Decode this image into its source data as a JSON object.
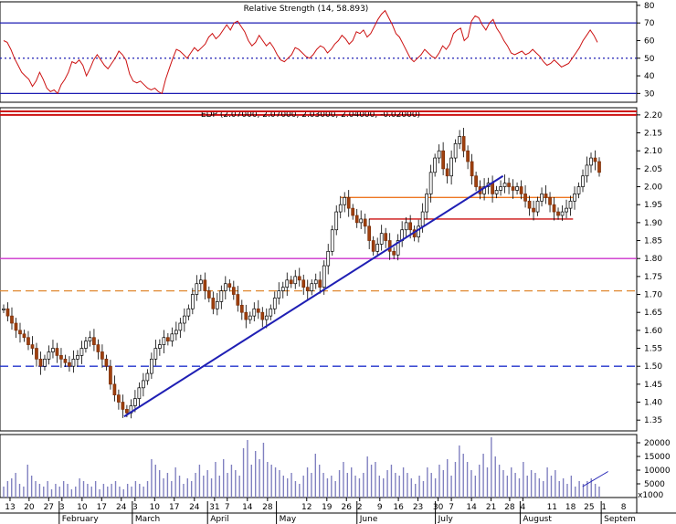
{
  "window": {
    "title": ""
  },
  "chart_data": [
    {
      "type": "line",
      "title": "Relative Strength (14, 58.893)",
      "ylim": [
        25,
        82
      ],
      "yticks": [
        30,
        40,
        50,
        60,
        70,
        80
      ],
      "grid": false,
      "reference_lines": [
        {
          "value": 70,
          "style": "solid",
          "color": "#1f1fb4"
        },
        {
          "value": 50,
          "style": "dotted",
          "color": "#1f1fb4"
        },
        {
          "value": 30,
          "style": "solid",
          "color": "#1f1fb4"
        }
      ],
      "series": [
        {
          "color": "#cc1111",
          "values": [
            60,
            59,
            55,
            50,
            46,
            42,
            40,
            38,
            34,
            37,
            42,
            38,
            33,
            31,
            32,
            30,
            35,
            38,
            42,
            48,
            47,
            49,
            46,
            40,
            44,
            49,
            52,
            49,
            46,
            44,
            47,
            50,
            54,
            52,
            49,
            41,
            37,
            36,
            37,
            35,
            33,
            32,
            33,
            31,
            30,
            38,
            44,
            50,
            55,
            54,
            52,
            50,
            53,
            56,
            54,
            56,
            58,
            62,
            64,
            61,
            63,
            66,
            69,
            66,
            70,
            71,
            68,
            65,
            60,
            57,
            59,
            63,
            60,
            57,
            59,
            56,
            52,
            49,
            48,
            50,
            52,
            56,
            55,
            53,
            51,
            50,
            52,
            55,
            57,
            56,
            53,
            55,
            58,
            60,
            63,
            61,
            58,
            60,
            65,
            64,
            66,
            62,
            64,
            68,
            72,
            75,
            77,
            73,
            69,
            64,
            62,
            58,
            54,
            50,
            48,
            50,
            52,
            55,
            53,
            51,
            50,
            53,
            57,
            55,
            58,
            64,
            66,
            67,
            60,
            62,
            71,
            74,
            73,
            69,
            66,
            70,
            72,
            67,
            64,
            60,
            57,
            53,
            52,
            53,
            54,
            52,
            53,
            55,
            53,
            51,
            48,
            46,
            47,
            49,
            47,
            45,
            46,
            47,
            50,
            53,
            56,
            60,
            63,
            66,
            63,
            59
          ]
        }
      ]
    },
    {
      "type": "candlestick",
      "title": "EDP (2.07000, 2.07000, 2.03000, 2.04000, -0.02000)",
      "ylim": [
        1.32,
        2.22
      ],
      "yticks": [
        1.35,
        1.4,
        1.45,
        1.5,
        1.55,
        1.6,
        1.65,
        1.7,
        1.75,
        1.8,
        1.85,
        1.9,
        1.95,
        2.0,
        2.05,
        2.1,
        2.15,
        2.2
      ],
      "grid": false,
      "reference_lines": [
        {
          "value": 2.2,
          "style": "solid",
          "color": "#cc1111"
        },
        {
          "value": 1.8,
          "style": "solid",
          "color": "#cc33cc"
        },
        {
          "value": 1.71,
          "style": "dashed",
          "color": "#e08a33"
        },
        {
          "value": 1.5,
          "style": "dashed",
          "color": "#2233cc"
        },
        {
          "value": 1.97,
          "style": "solid",
          "color": "#ee7722",
          "from": 0.535,
          "to": 0.9
        },
        {
          "value": 1.91,
          "style": "solid",
          "color": "#cc1111",
          "from": 0.58,
          "to": 0.9
        }
      ],
      "trend_lines": [
        {
          "color": "#1f1fb4",
          "from": [
            0.195,
            1.36
          ],
          "to": [
            0.79,
            2.03
          ]
        }
      ],
      "series": [
        {
          "name": "EDP",
          "close": [
            1.66,
            1.64,
            1.62,
            1.6,
            1.59,
            1.58,
            1.56,
            1.55,
            1.52,
            1.5,
            1.52,
            1.54,
            1.55,
            1.53,
            1.52,
            1.51,
            1.5,
            1.52,
            1.53,
            1.55,
            1.57,
            1.58,
            1.56,
            1.54,
            1.52,
            1.5,
            1.45,
            1.42,
            1.4,
            1.38,
            1.37,
            1.39,
            1.41,
            1.44,
            1.46,
            1.48,
            1.52,
            1.55,
            1.56,
            1.58,
            1.57,
            1.59,
            1.6,
            1.62,
            1.64,
            1.66,
            1.7,
            1.73,
            1.74,
            1.71,
            1.69,
            1.66,
            1.68,
            1.71,
            1.73,
            1.72,
            1.7,
            1.67,
            1.65,
            1.63,
            1.64,
            1.66,
            1.65,
            1.63,
            1.64,
            1.66,
            1.69,
            1.71,
            1.72,
            1.74,
            1.73,
            1.75,
            1.74,
            1.72,
            1.71,
            1.73,
            1.74,
            1.72,
            1.78,
            1.82,
            1.88,
            1.93,
            1.95,
            1.97,
            1.94,
            1.92,
            1.9,
            1.91,
            1.89,
            1.85,
            1.82,
            1.84,
            1.87,
            1.85,
            1.82,
            1.81,
            1.85,
            1.88,
            1.9,
            1.88,
            1.86,
            1.89,
            1.93,
            1.98,
            2.04,
            2.08,
            2.1,
            2.05,
            2.03,
            2.08,
            2.12,
            2.14,
            2.1,
            2.07,
            2.03,
            2.0,
            1.98,
            2.0,
            2.01,
            1.98,
            1.99,
            2.0,
            2.01,
            2.0,
            1.99,
            2.0,
            1.98,
            1.96,
            1.94,
            1.93,
            1.96,
            1.98,
            1.97,
            1.95,
            1.93,
            1.92,
            1.93,
            1.94,
            1.96,
            1.98,
            2.0,
            2.03,
            2.06,
            2.08,
            2.07,
            2.04
          ]
        }
      ]
    },
    {
      "type": "bar",
      "title": "",
      "ylim": [
        0,
        23000
      ],
      "yticks": [
        5000,
        10000,
        15000,
        20000
      ],
      "unit_label": "x1000",
      "xlabels": [
        {
          "pos": 0.012,
          "label": "13"
        },
        {
          "pos": 0.048,
          "label": "20"
        },
        {
          "pos": 0.085,
          "label": "27"
        },
        {
          "pos": 0.11,
          "label": "3"
        },
        {
          "pos": 0.148,
          "label": "10"
        },
        {
          "pos": 0.185,
          "label": "17"
        },
        {
          "pos": 0.222,
          "label": "24"
        },
        {
          "pos": 0.248,
          "label": "3"
        },
        {
          "pos": 0.285,
          "label": "10"
        },
        {
          "pos": 0.322,
          "label": "17"
        },
        {
          "pos": 0.36,
          "label": "24"
        },
        {
          "pos": 0.398,
          "label": "31"
        },
        {
          "pos": 0.422,
          "label": "7"
        },
        {
          "pos": 0.46,
          "label": "14"
        },
        {
          "pos": 0.498,
          "label": "28"
        },
        {
          "pos": 0.572,
          "label": "12"
        },
        {
          "pos": 0.61,
          "label": "19"
        },
        {
          "pos": 0.647,
          "label": "26"
        },
        {
          "pos": 0.672,
          "label": "2"
        },
        {
          "pos": 0.71,
          "label": "9"
        },
        {
          "pos": 0.745,
          "label": "16"
        },
        {
          "pos": 0.782,
          "label": "23"
        },
        {
          "pos": 0.82,
          "label": "30"
        },
        {
          "pos": 0.845,
          "label": "7"
        },
        {
          "pos": 0.883,
          "label": "14"
        },
        {
          "pos": 0.92,
          "label": "21"
        },
        {
          "pos": 0.955,
          "label": "28"
        },
        {
          "pos": 0.98,
          "label": "4"
        }
      ],
      "months": [
        {
          "pos": 0.11,
          "label": "February"
        },
        {
          "pos": 0.248,
          "label": "March"
        },
        {
          "pos": 0.39,
          "label": "April"
        },
        {
          "pos": 0.52,
          "label": "May"
        },
        {
          "pos": 0.672,
          "label": "June"
        },
        {
          "pos": 0.82,
          "label": "July"
        },
        {
          "pos": 0.98,
          "label": "August"
        }
      ],
      "extra_labels": [
        {
          "pos": 1.035,
          "label": "11"
        },
        {
          "pos": 1.07,
          "label": "18"
        },
        {
          "pos": 1.105,
          "label": "25"
        },
        {
          "pos": 1.133,
          "label": "1"
        },
        {
          "pos": 1.17,
          "label": "8"
        }
      ],
      "extra_months": [
        {
          "pos": 1.133,
          "label": "Septem"
        }
      ],
      "series": [
        {
          "name": "Volume",
          "color": "#8080c0",
          "values": [
            4000,
            6000,
            7000,
            9000,
            5000,
            4000,
            12000,
            8000,
            6000,
            5000,
            4000,
            6000,
            3000,
            5000,
            4000,
            6000,
            5000,
            3000,
            4000,
            7000,
            6000,
            5000,
            4000,
            6000,
            3000,
            5000,
            4000,
            5000,
            6000,
            4000,
            3000,
            5000,
            4000,
            6000,
            5000,
            4000,
            6000,
            14000,
            12000,
            10000,
            7000,
            9000,
            6000,
            11000,
            8000,
            5000,
            7000,
            6000,
            9000,
            12000,
            8000,
            10000,
            7000,
            13000,
            8000,
            14000,
            9000,
            12000,
            10000,
            8000,
            18000,
            21000,
            12000,
            17000,
            14000,
            20000,
            13000,
            12000,
            11000,
            10000,
            8000,
            7000,
            9000,
            6000,
            5000,
            8000,
            11000,
            9000,
            16000,
            12000,
            9000,
            7000,
            8000,
            6000,
            10000,
            13000,
            9000,
            11000,
            8000,
            7000,
            9000,
            15000,
            12000,
            13000,
            8000,
            7000,
            10000,
            12000,
            9000,
            8000,
            11000,
            9000,
            7000,
            5000,
            8000,
            6000,
            11000,
            9000,
            7000,
            12000,
            10000,
            14000,
            8000,
            13000,
            19000,
            16000,
            13000,
            10000,
            8000,
            12000,
            16000,
            11000,
            22000,
            15000,
            12000,
            10000,
            8000,
            11000,
            9000,
            7000,
            13000,
            8000,
            10000,
            9000,
            7000,
            6000,
            11000,
            8000,
            10000,
            6000,
            7000,
            5000,
            8000,
            4000,
            6000,
            5000,
            6000,
            7000,
            5000,
            4000
          ]
        }
      ],
      "trend_lines": [
        {
          "color": "#1f1fb4",
          "from": [
            0.915,
            4000
          ],
          "to": [
            0.955,
            9500
          ]
        }
      ]
    }
  ]
}
